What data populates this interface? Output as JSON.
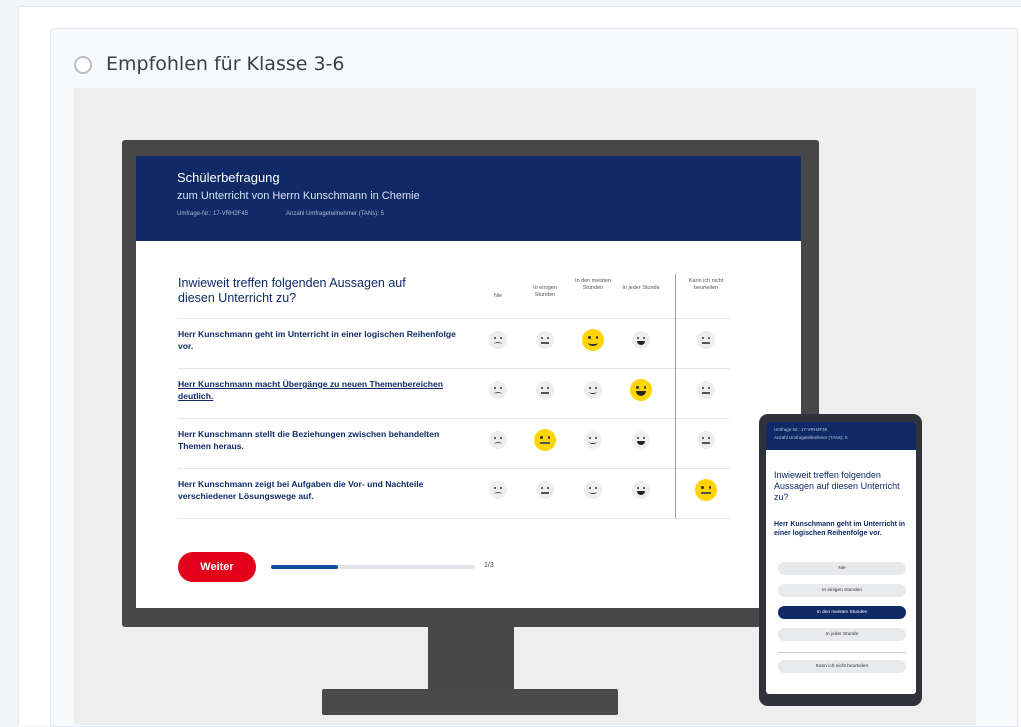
{
  "option": {
    "label": "Empfohlen für Klasse 3-6"
  },
  "survey": {
    "title": "Schülerbefragung",
    "subtitle": "zum Unterricht von Herrn Kunschmann in Chemie",
    "meta_id": "Umfrage-Nr.: 17-VRH2F45",
    "meta_participants": "Anzahl Umfrageteilnehmer (TANs): 5",
    "question": "Inwieweit treffen folgenden Aussagen auf diesen Unterricht zu?",
    "columns": [
      "Nie",
      "In einigen Stunden",
      "In den meisten Stunden",
      "In jeder Stunde",
      "Kann ich nicht beurteilen"
    ],
    "rows": [
      {
        "text": "Herr Kunschmann geht im Unterricht in einer logischen Reihenfolge vor.",
        "selected": 2
      },
      {
        "text": "Herr Kunschmann macht Übergänge zu neuen Themenbereichen deutlich.",
        "selected": 3
      },
      {
        "text": "Herr Kunschmann stellt die Beziehungen zwischen behandelten Themen heraus.",
        "selected": 1
      },
      {
        "text": "Herr Kunschmann zeigt bei Aufgaben die Vor- und Nachteile verschiedener Lösungswege auf.",
        "selected": 4
      }
    ],
    "next_label": "Weiter",
    "progress": 0.33,
    "page_count": "1/3"
  },
  "phone": {
    "meta_id": "Umfrage-Nr.: 17-VRH2F45",
    "meta_participants": "Anzahl Umfrageteilnehmer (TANs): 5",
    "question": "Inwieweit treffen folgenden Aussagen auf diesen Unterricht zu?",
    "statement": "Herr Kunschmann geht im Unterricht in einer logischen Reihenfolge vor.",
    "options": [
      "Nie",
      "In einigen Stunden",
      "In den meisten Stunden",
      "In jeder Stunde"
    ],
    "selected": 2,
    "cannot_judge": "Kann ich nicht beurteilen"
  },
  "colors": {
    "navy": "#0f2a67",
    "accent_red": "#e2001a",
    "face_selected": "#ffd400"
  },
  "icons": {
    "faces": [
      "sad-face-icon",
      "neutral-face-icon",
      "smile-face-icon",
      "grin-face-icon",
      "neutral-face-icon"
    ]
  }
}
